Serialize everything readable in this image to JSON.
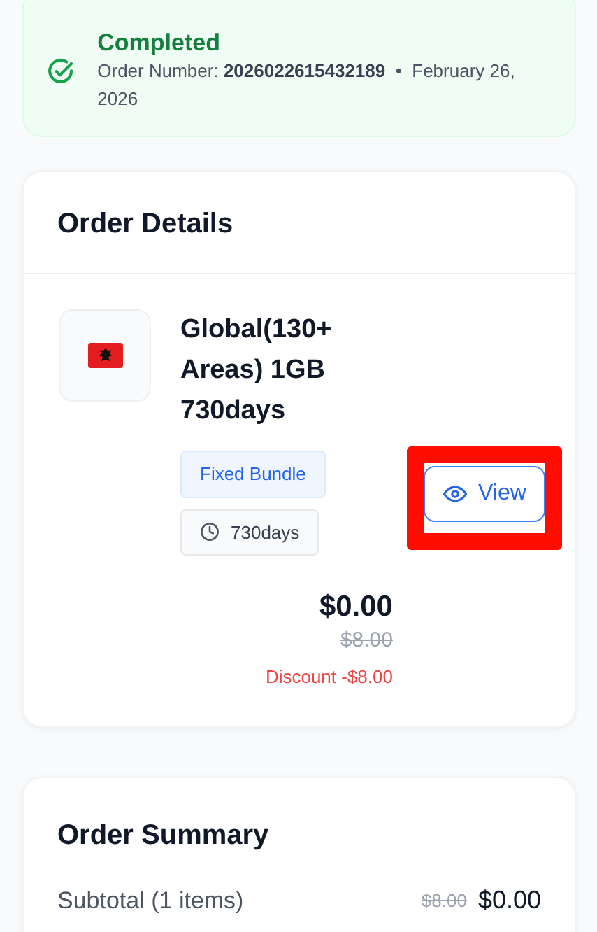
{
  "status": {
    "title": "Completed",
    "order_number_label": "Order Number:",
    "order_number": "2026022615432189",
    "separator": "•",
    "date": "February 26, 2026"
  },
  "order_details": {
    "title": "Order Details",
    "product": {
      "name": "Global(130+ Areas) 1GB 730days",
      "bundle_type": "Fixed Bundle",
      "duration": "730days",
      "view_button": {
        "label": "View",
        "highlighted": true
      },
      "price": "$0.00",
      "original_price": "$8.00",
      "discount": "Discount -$8.00"
    }
  },
  "order_summary": {
    "title": "Order Summary",
    "rows": [
      {
        "label": "Subtotal (1 items)",
        "original_value": "$8.00",
        "value": "$0.00"
      }
    ]
  }
}
